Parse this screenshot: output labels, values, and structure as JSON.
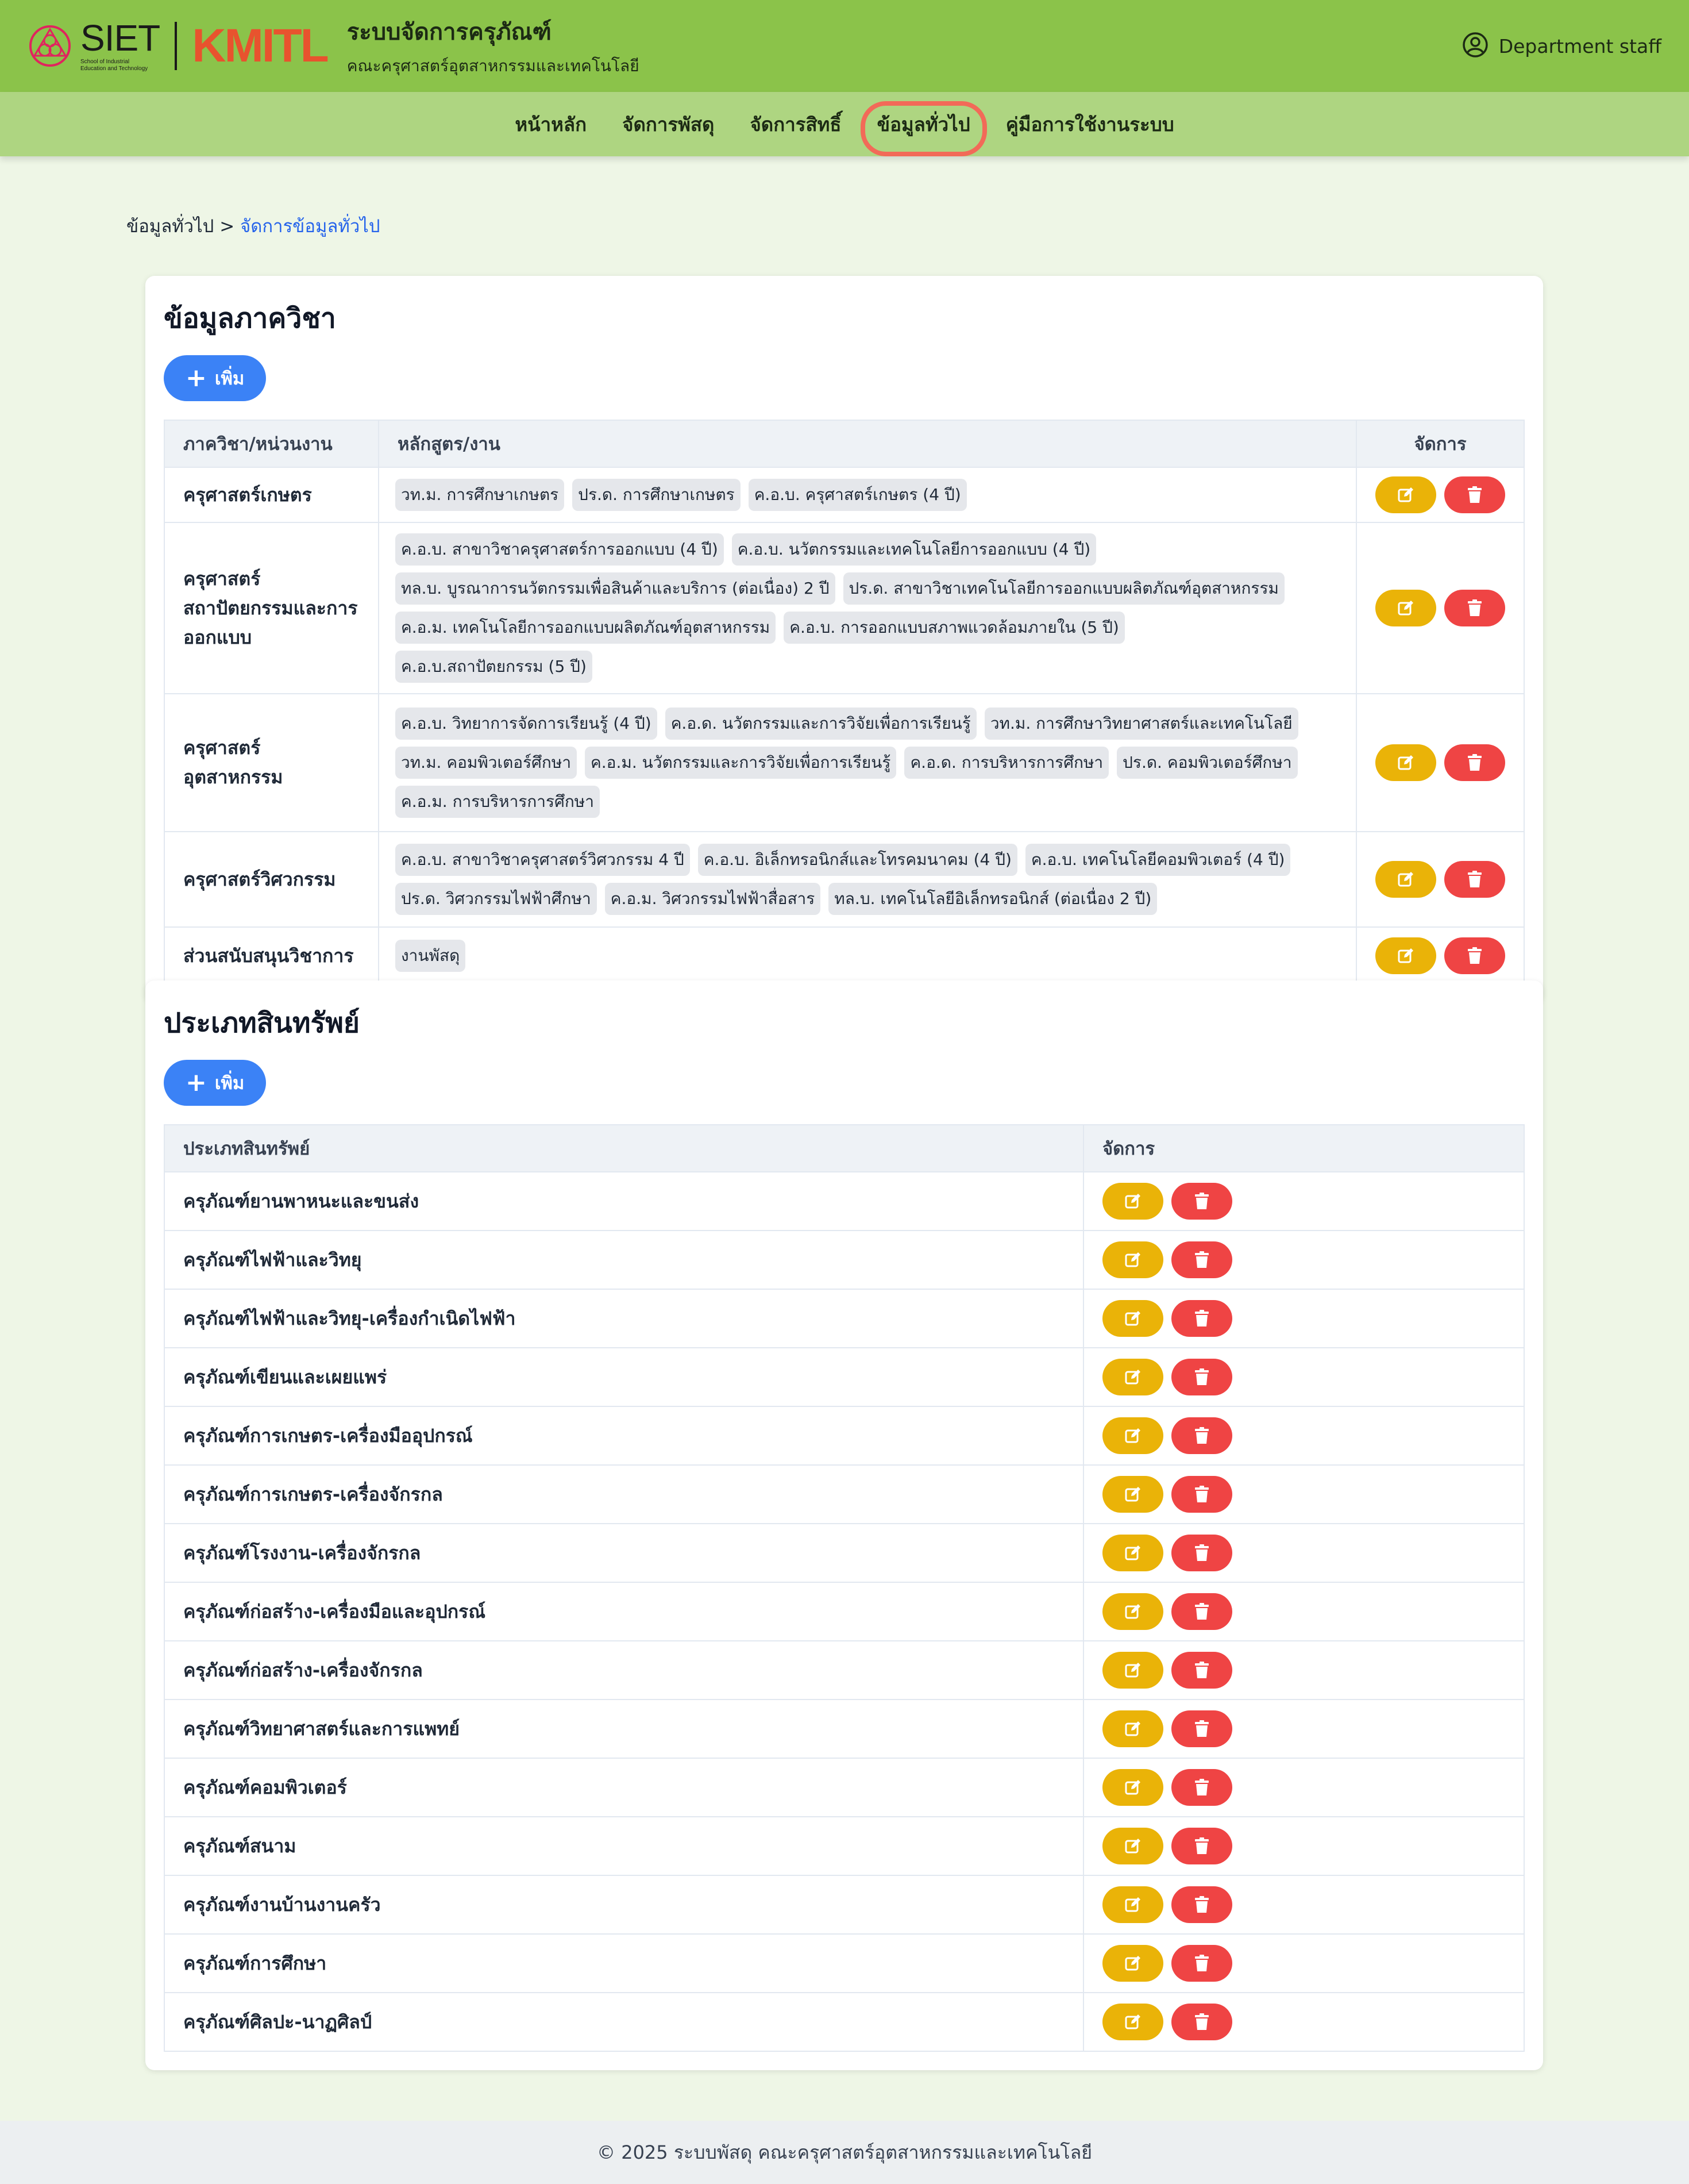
{
  "header": {
    "logo_siet": "SIET",
    "logo_siet_sub1": "School of Industrial",
    "logo_siet_sub2": "Education and Technology",
    "logo_kmitl": "KMITL",
    "title": "ระบบจัดการครุภัณฑ์",
    "subtitle": "คณะครุศาสตร์อุตสาหกรรมและเทคโนโลยี",
    "user_label": "Department staff",
    "colors": {
      "header_bg": "#8bc34a",
      "nav_bg": "#aed581",
      "accent": "#3b82f6"
    }
  },
  "nav": {
    "items": [
      {
        "label": "หน้าหลัก"
      },
      {
        "label": "จัดการพัสดุ"
      },
      {
        "label": "จัดการสิทธิ์"
      },
      {
        "label": "ข้อมูลทั่วไป",
        "active": true
      },
      {
        "label": "คู่มือการใช้งานระบบ"
      }
    ]
  },
  "breadcrumb": {
    "parent": "ข้อมูลทั่วไป",
    "separator": " > ",
    "current": "จัดการข้อมูลทั่วไป"
  },
  "departments": {
    "title": "ข้อมูลภาควิชา",
    "add_label": "เพิ่ม",
    "columns": [
      "ภาควิชา/หน่วนงาน",
      "หลักสูตร/งาน",
      "จัดการ"
    ],
    "rows": [
      {
        "name": "ครุศาสตร์เกษตร",
        "programs": [
          "วท.ม. การศึกษาเกษตร",
          "ปร.ด. การศึกษาเกษตร",
          "ค.อ.บ. ครุศาสตร์เกษตร (4 ปี)"
        ]
      },
      {
        "name": "ครุศาสตร์สถาปัตยกรรมและการออกแบบ",
        "programs": [
          "ค.อ.บ. สาขาวิชาครุศาสตร์การออกแบบ (4 ปี)",
          "ค.อ.บ. นวัตกรรมและเทคโนโลยีการออกแบบ (4 ปี)",
          "ทล.บ. บูรณาการนวัตกรรมเพื่อสินค้าและบริการ (ต่อเนื่อง) 2 ปี",
          "ปร.ด. สาขาวิชาเทคโนโลยีการออกแบบผลิตภัณฑ์อุตสาหกรรม",
          "ค.อ.ม. เทคโนโลยีการออกแบบผลิตภัณฑ์อุตสาหกรรม",
          "ค.อ.บ. การออกแบบสภาพแวดล้อมภายใน (5 ปี)",
          "ค.อ.บ.สถาปัตยกรรม (5 ปี)"
        ]
      },
      {
        "name": "ครุศาสตร์อุตสาหกรรม",
        "programs": [
          "ค.อ.บ. วิทยาการจัดการเรียนรู้ (4 ปี)",
          "ค.อ.ด. นวัตกรรมและการวิจัยเพื่อการเรียนรู้",
          "วท.ม. การศึกษาวิทยาศาสตร์และเทคโนโลยี",
          "วท.ม. คอมพิวเตอร์ศึกษา",
          "ค.อ.ม. นวัตกรรมและการวิจัยเพื่อการเรียนรู้",
          "ค.อ.ด. การบริหารการศึกษา",
          "ปร.ด. คอมพิวเตอร์ศึกษา",
          "ค.อ.ม. การบริหารการศึกษา"
        ]
      },
      {
        "name": "ครุศาสตร์วิศวกรรม",
        "programs": [
          "ค.อ.บ. สาขาวิชาครุศาสตร์วิศวกรรม 4 ปี",
          "ค.อ.บ. อิเล็กทรอนิกส์และโทรคมนาคม (4 ปี)",
          "ค.อ.บ. เทคโนโลยีคอมพิวเตอร์ (4 ปี)",
          "ปร.ด. วิศวกรรมไฟฟ้าศึกษา",
          "ค.อ.ม. วิศวกรรมไฟฟ้าสื่อสาร",
          "ทล.บ. เทคโนโลยีอิเล็กทรอนิกส์ (ต่อเนื่อง 2 ปี)"
        ]
      },
      {
        "name": "ส่วนสนับสนุนวิชาการ",
        "programs": [
          "งานพัสดุ"
        ]
      }
    ]
  },
  "asset_types": {
    "title": "ประเภทสินทรัพย์",
    "add_label": "เพิ่ม",
    "columns": [
      "ประเภทสินทรัพย์",
      "จัดการ"
    ],
    "rows": [
      "ครุภัณฑ์ยานพาหนะและขนส่ง",
      "ครุภัณฑ์ไฟฟ้าและวิทยุ",
      "ครุภัณฑ์ไฟฟ้าและวิทยุ-เครื่องกำเนิดไฟฟ้า",
      "ครุภัณฑ์เขียนและเผยแพร่",
      "ครุภัณฑ์การเกษตร-เครื่องมืออุปกรณ์",
      "ครุภัณฑ์การเกษตร-เครื่องจักรกล",
      "ครุภัณฑ์โรงงาน-เครื่องจักรกล",
      "ครุภัณฑ์ก่อสร้าง-เครื่องมือและอุปกรณ์",
      "ครุภัณฑ์ก่อสร้าง-เครื่องจักรกล",
      "ครุภัณฑ์วิทยาศาสตร์และการแพทย์",
      "ครุภัณฑ์คอมพิวเตอร์",
      "ครุภัณฑ์สนาม",
      "ครุภัณฑ์งานบ้านงานครัว",
      "ครุภัณฑ์การศึกษา",
      "ครุภัณฑ์ศิลปะ-นาฏศิลป์"
    ]
  },
  "footer": {
    "text": "© 2025 ระบบพัสดุ คณะครุศาสตร์อุตสาหกรรมและเทคโนโลยี"
  },
  "icons": {
    "edit": "edit-icon",
    "delete": "trash-icon",
    "user": "user-circle-icon",
    "add": "plus-icon"
  }
}
